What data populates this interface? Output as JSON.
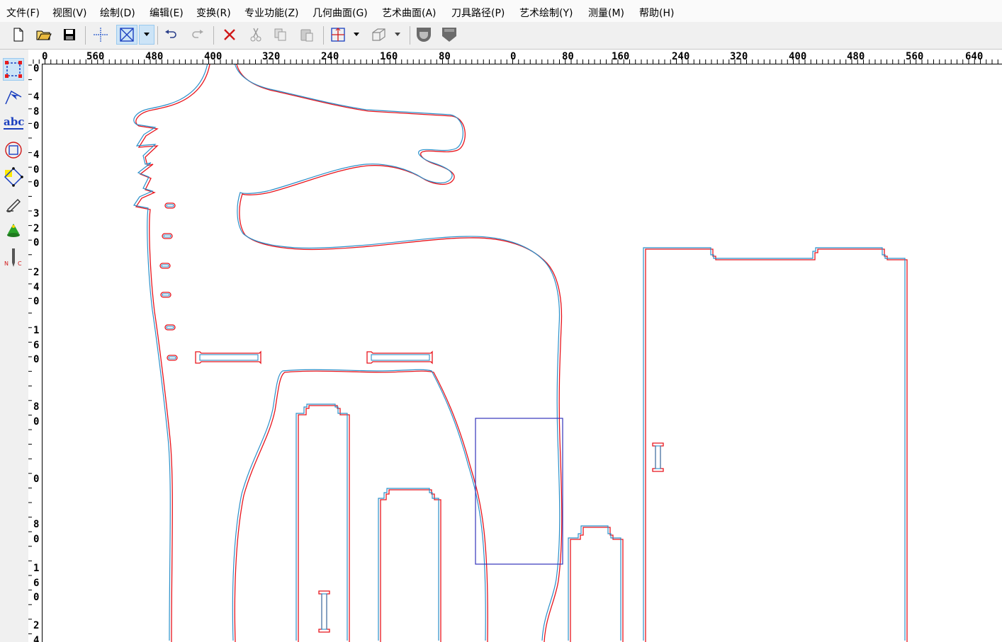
{
  "menu": [
    "文件(F)",
    "视图(V)",
    "绘制(D)",
    "编辑(E)",
    "变换(R)",
    "专业功能(Z)",
    "几何曲面(G)",
    "艺术曲面(A)",
    "刀具路径(P)",
    "艺术绘制(Y)",
    "测量(M)",
    "帮助(H)"
  ],
  "toolbar": [
    {
      "name": "new-file-icon"
    },
    {
      "name": "open-folder-icon"
    },
    {
      "name": "save-icon"
    },
    {
      "name": "crosshair-icon"
    },
    {
      "name": "select-box-icon"
    },
    {
      "name": "dropdown-arrow-icon"
    },
    {
      "name": "undo-icon"
    },
    {
      "name": "redo-icon"
    },
    {
      "name": "delete-icon"
    },
    {
      "name": "cut-icon"
    },
    {
      "name": "copy-icon"
    },
    {
      "name": "paste-icon"
    },
    {
      "name": "origin-icon"
    },
    {
      "name": "view-3d-icon"
    },
    {
      "name": "tool-shape-icon"
    },
    {
      "name": "tool-shape-2-icon"
    }
  ],
  "left_tools": [
    "select-node-icon",
    "curve-edit-icon",
    "text-tool-icon",
    "shape-tool-icon",
    "polygon-tool-icon",
    "pen-tool-icon",
    "fill-tool-icon",
    "nc-tool-icon"
  ],
  "rulers": {
    "horizontal": [
      "0",
      "560",
      "480",
      "400",
      "320",
      "240",
      "160",
      "80",
      "0",
      "80",
      "160",
      "240",
      "320",
      "400",
      "480",
      "560",
      "640"
    ],
    "vertical": [
      [
        "0"
      ],
      [
        "4",
        "8",
        "0"
      ],
      [
        "4",
        "0",
        "0"
      ],
      [
        "3",
        "2",
        "0"
      ],
      [
        "2",
        "4",
        "0"
      ],
      [
        "1",
        "6",
        "0"
      ],
      [
        "8",
        "0"
      ],
      [
        "0"
      ],
      [
        "8",
        "0"
      ],
      [
        "1",
        "6",
        "0"
      ],
      [
        "2",
        "4"
      ]
    ]
  },
  "colors": {
    "outline_red": "#e8141c",
    "outline_blue": "#2b8fc9",
    "selection_box": "#3333bb",
    "canvas": "#ffffff"
  }
}
